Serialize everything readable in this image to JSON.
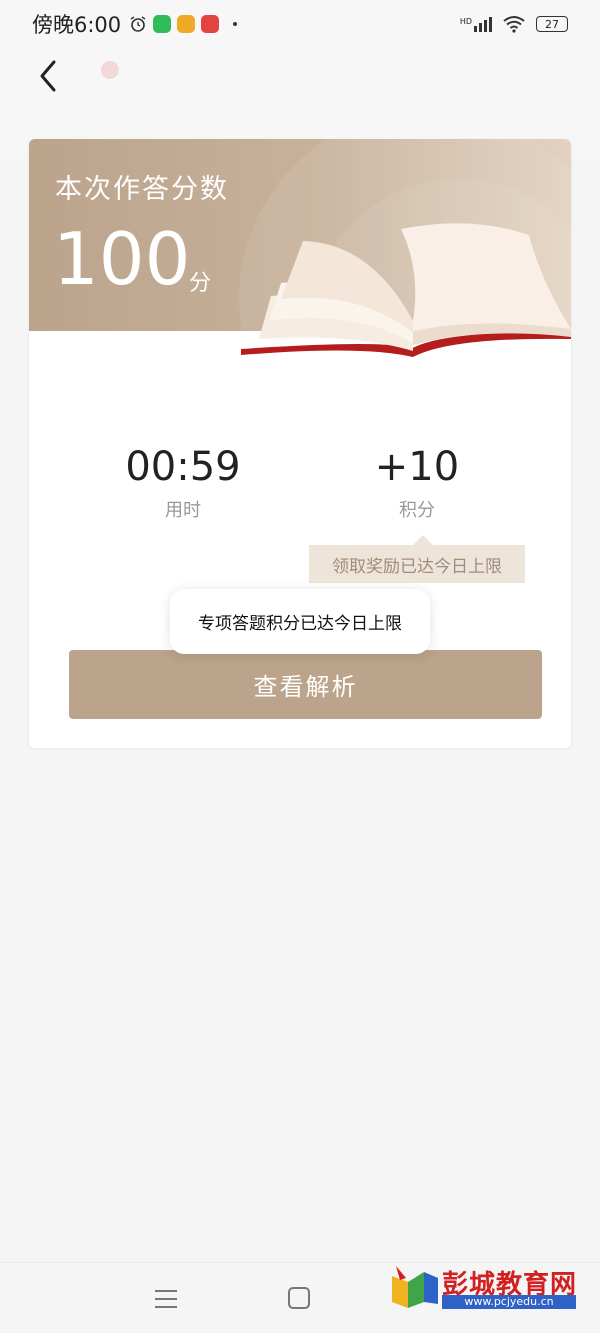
{
  "status_bar": {
    "time": "傍晚6:00",
    "signal_label": "HD",
    "battery": "27"
  },
  "result": {
    "title": "本次作答分数",
    "score": "100",
    "score_unit": "分"
  },
  "stats": {
    "time_value": "00:59",
    "time_label": "用时",
    "points_value": "+10",
    "points_label": "积分"
  },
  "reward_tip": "领取奖励已达今日上限",
  "toast": "专项答题积分已达今日上限",
  "view_analysis_button": "查看解析",
  "watermark": {
    "title": "彭城教育网",
    "url": "www.pcjyedu.cn"
  },
  "colors": {
    "accent": "#bca38b",
    "header_gradient_end": "#e2d2bf",
    "book_red": "#b51d1d",
    "watermark_red": "#d21f1f",
    "watermark_blue": "#2f62c7"
  }
}
